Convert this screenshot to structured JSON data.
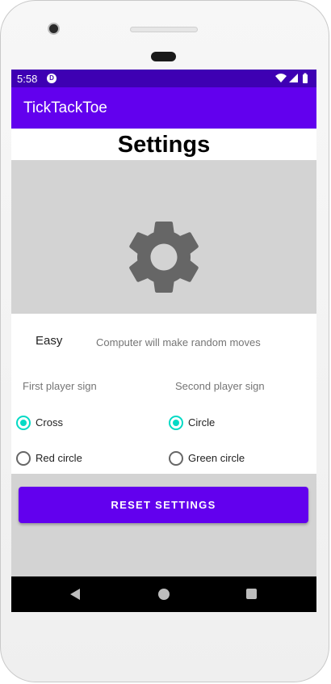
{
  "status_bar": {
    "time": "5:58",
    "app_icon": "D"
  },
  "app_bar": {
    "title": "TickTackToe"
  },
  "settings": {
    "title": "Settings",
    "difficulty": "Easy",
    "difficulty_description": "Computer will make random moves",
    "first_player": {
      "label": "First player sign",
      "options": [
        {
          "label": "Cross",
          "checked": true
        },
        {
          "label": "Red circle",
          "checked": false
        }
      ]
    },
    "second_player": {
      "label": "Second player sign",
      "options": [
        {
          "label": "Circle",
          "checked": true
        },
        {
          "label": "Green circle",
          "checked": false
        }
      ]
    },
    "reset_label": "RESET SETTINGS"
  },
  "colors": {
    "status_bar": "#3e00b3",
    "primary": "#6200ee",
    "accent": "#03dac5",
    "icon_gray": "#666666"
  },
  "icons": {
    "gear": "gear-icon",
    "back": "back-triangle-icon",
    "home": "home-circle-icon",
    "recent": "recent-square-icon"
  }
}
